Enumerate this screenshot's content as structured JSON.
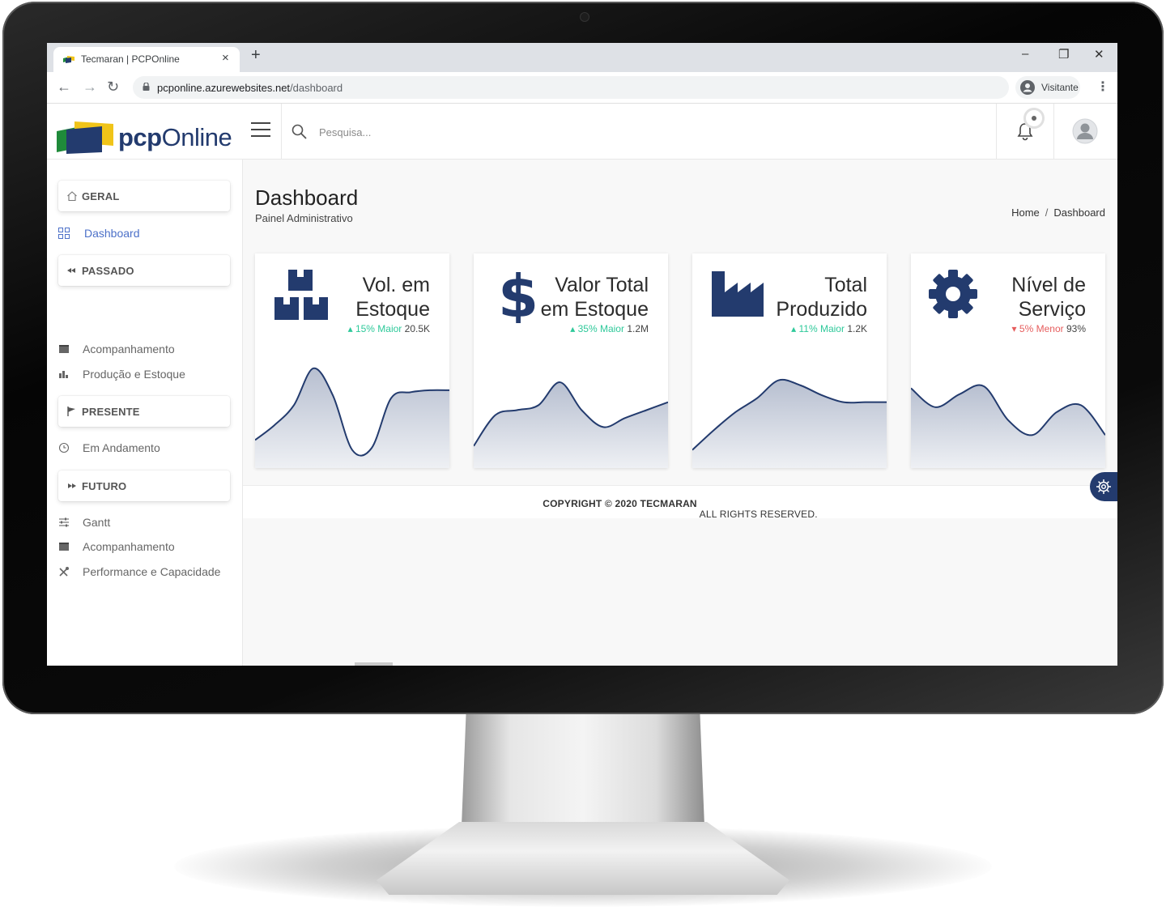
{
  "browser": {
    "tab_title": "Tecmaran | PCPOnline",
    "new_tab": "+",
    "tab_close": "×",
    "window": {
      "minimize": "–",
      "restore": "❐",
      "close": "✕"
    },
    "nav": {
      "back": "←",
      "forward": "→",
      "reload": "↻"
    },
    "url_host": "pcponline.azurewebsites.net",
    "url_path": "/dashboard",
    "profile": "Visitante",
    "menu": "⋮"
  },
  "header": {
    "logo_bold": "pcp",
    "logo_light": "Online",
    "search_placeholder": "Pesquisa..."
  },
  "sidebar": {
    "sections": [
      {
        "label": "GERAL",
        "icon": "home-icon"
      },
      {
        "label": "PASSADO",
        "icon": "rewind-icon"
      },
      {
        "label": "PRESENTE",
        "icon": "flag-icon"
      },
      {
        "label": "FUTURO",
        "icon": "fast-forward-icon"
      }
    ],
    "items": [
      {
        "label": "Dashboard",
        "icon": "grid-icon",
        "active": true
      },
      {
        "label": "Acompanhamento",
        "icon": "window-icon"
      },
      {
        "label": "Produção e Estoque",
        "icon": "bar-chart-icon"
      },
      {
        "label": "Em Andamento",
        "icon": "clock-icon"
      },
      {
        "label": "Gantt",
        "icon": "sliders-icon"
      },
      {
        "label": "Acompanhamento",
        "icon": "window-icon"
      },
      {
        "label": "Performance e Capacidade",
        "icon": "tools-icon"
      }
    ]
  },
  "page": {
    "title": "Dashboard",
    "subtitle": "Painel Administrativo",
    "breadcrumb": [
      "Home",
      "/",
      "Dashboard"
    ]
  },
  "cards": [
    {
      "title_line1": "Vol. em",
      "title_line2": "Estoque",
      "trend_arrow": "▴",
      "trend_text": "15% Maior",
      "trend": "up",
      "value": "20.5K",
      "icon": "boxes-icon",
      "spark": [
        0.2,
        0.35,
        0.55,
        0.92,
        0.65,
        0.1,
        0.12,
        0.62,
        0.68,
        0.7,
        0.7
      ]
    },
    {
      "title_line1": "Valor Total",
      "title_line2": "em Estoque",
      "trend_arrow": "▴",
      "trend_text": "35% Maior",
      "trend": "up",
      "value": "1.2M",
      "icon": "dollar-icon",
      "spark": [
        0.14,
        0.45,
        0.5,
        0.55,
        0.78,
        0.5,
        0.33,
        0.42,
        0.5,
        0.58
      ]
    },
    {
      "title_line1": "Total",
      "title_line2": "Produzido",
      "trend_arrow": "▴",
      "trend_text": "11% Maior",
      "trend": "up",
      "value": "1.2K",
      "icon": "factory-icon",
      "spark": [
        0.1,
        0.3,
        0.48,
        0.62,
        0.8,
        0.75,
        0.65,
        0.58,
        0.58,
        0.58
      ]
    },
    {
      "title_line1": "Nível de",
      "title_line2": "Serviço",
      "trend_arrow": "▾",
      "trend_text": "5% Menor",
      "trend": "down",
      "value": "93%",
      "icon": "gear-icon",
      "spark": [
        0.72,
        0.53,
        0.66,
        0.74,
        0.4,
        0.25,
        0.48,
        0.55,
        0.25
      ]
    }
  ],
  "footer": {
    "bold": "COPYRIGHT © 2020 TECMARAN",
    "rest": " ALL RIGHTS RESERVED."
  },
  "colors": {
    "brand_navy": "#233b6e",
    "accent_blue": "#4c70c8",
    "trend_up": "#2ec99a",
    "trend_down": "#e65d5d",
    "spark_fill": "#c9cfdb"
  }
}
